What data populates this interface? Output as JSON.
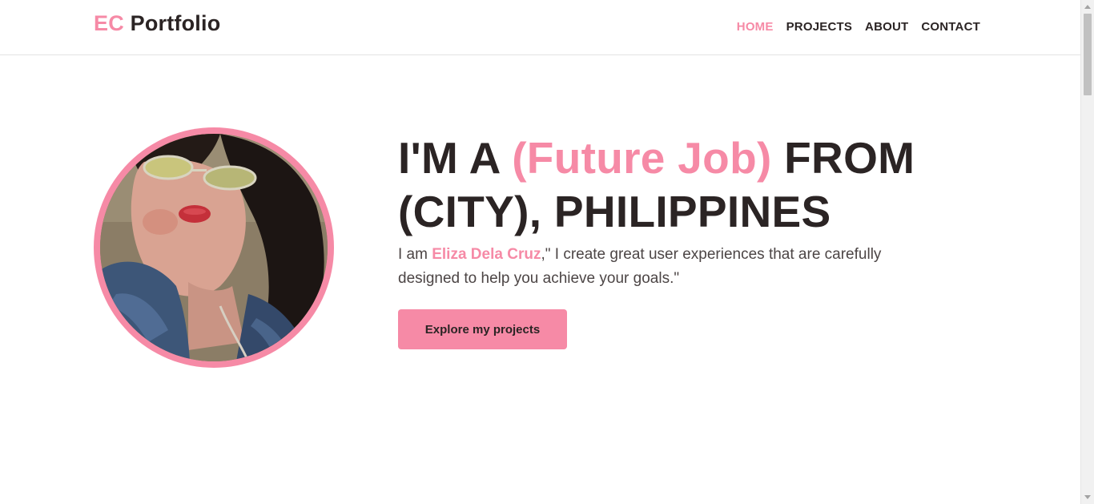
{
  "header": {
    "brand_accent": "EC",
    "brand_name": "Portfolio",
    "nav": [
      {
        "label": "HOME",
        "active": true
      },
      {
        "label": "PROJECTS",
        "active": false
      },
      {
        "label": "ABOUT",
        "active": false
      },
      {
        "label": "CONTACT",
        "active": false
      }
    ]
  },
  "hero": {
    "headline_part1": "I'M A ",
    "headline_highlight": "(Future Job)",
    "headline_part2": " FROM (CITY), PHILIPPINES",
    "intro_prefix": "I am ",
    "intro_name": "Eliza Dela Cruz",
    "intro_suffix": ",\" I create great user experiences that are carefully designed to help you achieve your goals.\"",
    "cta_label": "Explore my projects"
  },
  "colors": {
    "accent": "#f68aa6",
    "text": "#2b2424",
    "muted_text": "#4c4545"
  },
  "icons": {
    "avatar": "profile-photo"
  }
}
